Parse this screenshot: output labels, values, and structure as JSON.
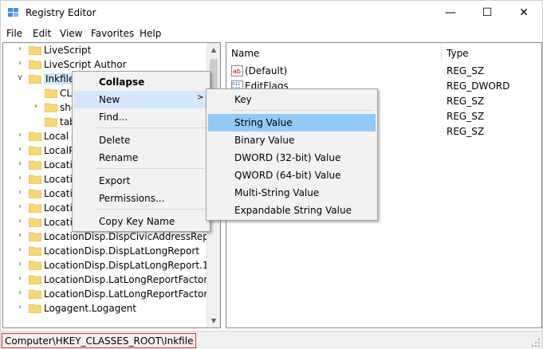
{
  "window": {
    "title": "Registry Editor",
    "min_glyph": "—",
    "max_glyph": "☐",
    "close_glyph": "✕"
  },
  "menubar": [
    "File",
    "Edit",
    "View",
    "Favorites",
    "Help"
  ],
  "tree": [
    {
      "label": "LiveScript",
      "indent": 0,
      "expander": ">"
    },
    {
      "label": "LiveScript Author",
      "indent": 0,
      "expander": ">"
    },
    {
      "label": "Inkfile",
      "indent": 0,
      "expander": "v",
      "selected": true
    },
    {
      "label": "CL",
      "indent": 1,
      "expander": ""
    },
    {
      "label": "she",
      "indent": 1,
      "expander": ">"
    },
    {
      "label": "tab",
      "indent": 1,
      "expander": ""
    },
    {
      "label": "Local S",
      "indent": 0,
      "expander": ">"
    },
    {
      "label": "LocalP",
      "indent": 0,
      "expander": ">"
    },
    {
      "label": "Locatio",
      "indent": 0,
      "expander": ">"
    },
    {
      "label": "Locatio",
      "indent": 0,
      "expander": ">"
    },
    {
      "label": "Locatio",
      "indent": 0,
      "expander": ">"
    },
    {
      "label": "Locatio",
      "indent": 0,
      "expander": ">"
    },
    {
      "label": "Locatio",
      "indent": 0,
      "expander": ">"
    },
    {
      "label": "LocationDisp.DispCivicAddressReport.",
      "indent": 0,
      "expander": ">"
    },
    {
      "label": "LocationDisp.DispLatLongReport",
      "indent": 0,
      "expander": ">"
    },
    {
      "label": "LocationDisp.DispLatLongReport.1",
      "indent": 0,
      "expander": ">"
    },
    {
      "label": "LocationDisp.LatLongReportFactory",
      "indent": 0,
      "expander": ">"
    },
    {
      "label": "LocationDisp.LatLongReportFactory.1",
      "indent": 0,
      "expander": ">"
    },
    {
      "label": "Logagent.Logagent",
      "indent": 0,
      "expander": ">"
    }
  ],
  "values": {
    "columns": {
      "name": "Name",
      "type": "Type"
    },
    "rows": [
      {
        "name": "(Default)",
        "type": "REG_SZ",
        "icon": "string-value-icon"
      },
      {
        "name": "EditFlags",
        "type": "REG_DWORD",
        "icon": "binary-value-icon"
      },
      {
        "name": "",
        "type": "REG_SZ",
        "icon": ""
      },
      {
        "name": "",
        "type": "REG_SZ",
        "icon": ""
      },
      {
        "name": "",
        "type": "REG_SZ",
        "icon": ""
      }
    ]
  },
  "context_menu": {
    "items": [
      "Collapse",
      "New",
      "Find...",
      "Delete",
      "Rename",
      "Export",
      "Permissions...",
      "Copy Key Name"
    ],
    "submenu_arrow": ">"
  },
  "new_submenu": {
    "items": [
      "Key",
      "String Value",
      "Binary Value",
      "DWORD (32-bit) Value",
      "QWORD (64-bit) Value",
      "Multi-String Value",
      "Expandable String Value"
    ],
    "highlighted": "String Value"
  },
  "status": {
    "path": "Computer\\HKEY_CLASSES_ROOT\\Inkfile"
  },
  "colors": {
    "selection": "#cce8ff",
    "menu_highlight": "#91c9f7",
    "status_border": "#e03030",
    "folder": "#f8d775"
  }
}
